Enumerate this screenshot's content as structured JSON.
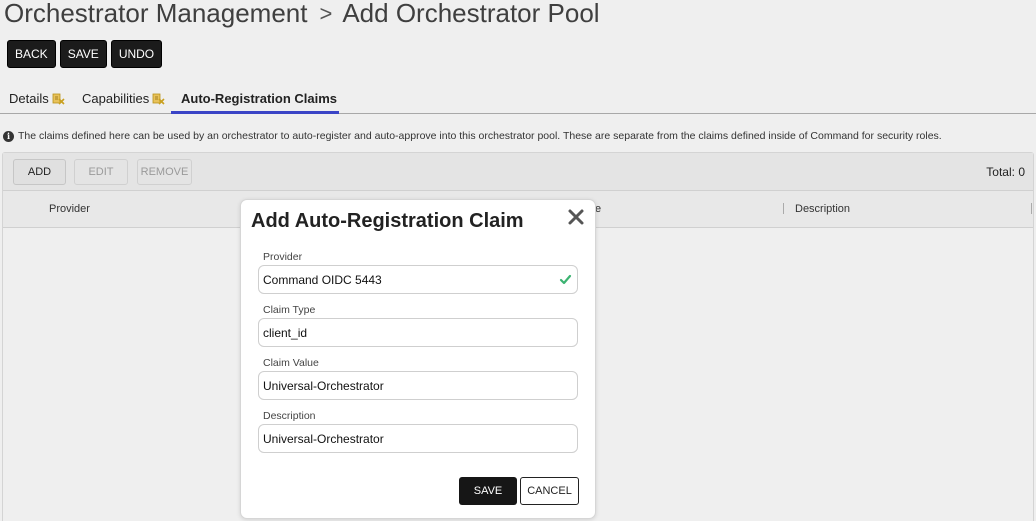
{
  "header": {
    "section": "Orchestrator Management",
    "separator": ">",
    "page": "Add Orchestrator Pool"
  },
  "toolbar": {
    "back_label": "BACK",
    "save_label": "SAVE",
    "undo_label": "UNDO"
  },
  "tabs": [
    {
      "label": "Details",
      "active": false,
      "warning": true
    },
    {
      "label": "Capabilities",
      "active": false,
      "warning": true
    },
    {
      "label": "Auto-Registration Claims",
      "active": true,
      "warning": false
    }
  ],
  "info_text": "The claims defined here can be used by an orchestrator to auto-register and auto-approve into this orchestrator pool. These are separate from the claims defined inside of Command for security roles.",
  "grid": {
    "add_label": "ADD",
    "edit_label": "EDIT",
    "remove_label": "REMOVE",
    "total_text": "Total: 0",
    "columns": [
      {
        "label": "Provider"
      },
      {
        "label": "e"
      },
      {
        "label": "Description"
      }
    ]
  },
  "modal": {
    "title": "Add Auto-Registration Claim",
    "fields": [
      {
        "label": "Provider",
        "value": "Command OIDC 5443",
        "valid": true
      },
      {
        "label": "Claim Type",
        "value": "client_id"
      },
      {
        "label": "Claim Value",
        "value": "Universal-Orchestrator"
      },
      {
        "label": "Description",
        "value": "Universal-Orchestrator"
      }
    ],
    "save_label": "SAVE",
    "cancel_label": "CANCEL"
  },
  "colors": {
    "accent": "#3a44c6",
    "valid": "#3cb371",
    "warning": "#d4a017",
    "button_dark": "#1b1b1b"
  },
  "icons": {
    "tab_warning": "warning-badge-icon",
    "info": "info-icon",
    "close": "close-icon",
    "valid": "check-icon"
  }
}
